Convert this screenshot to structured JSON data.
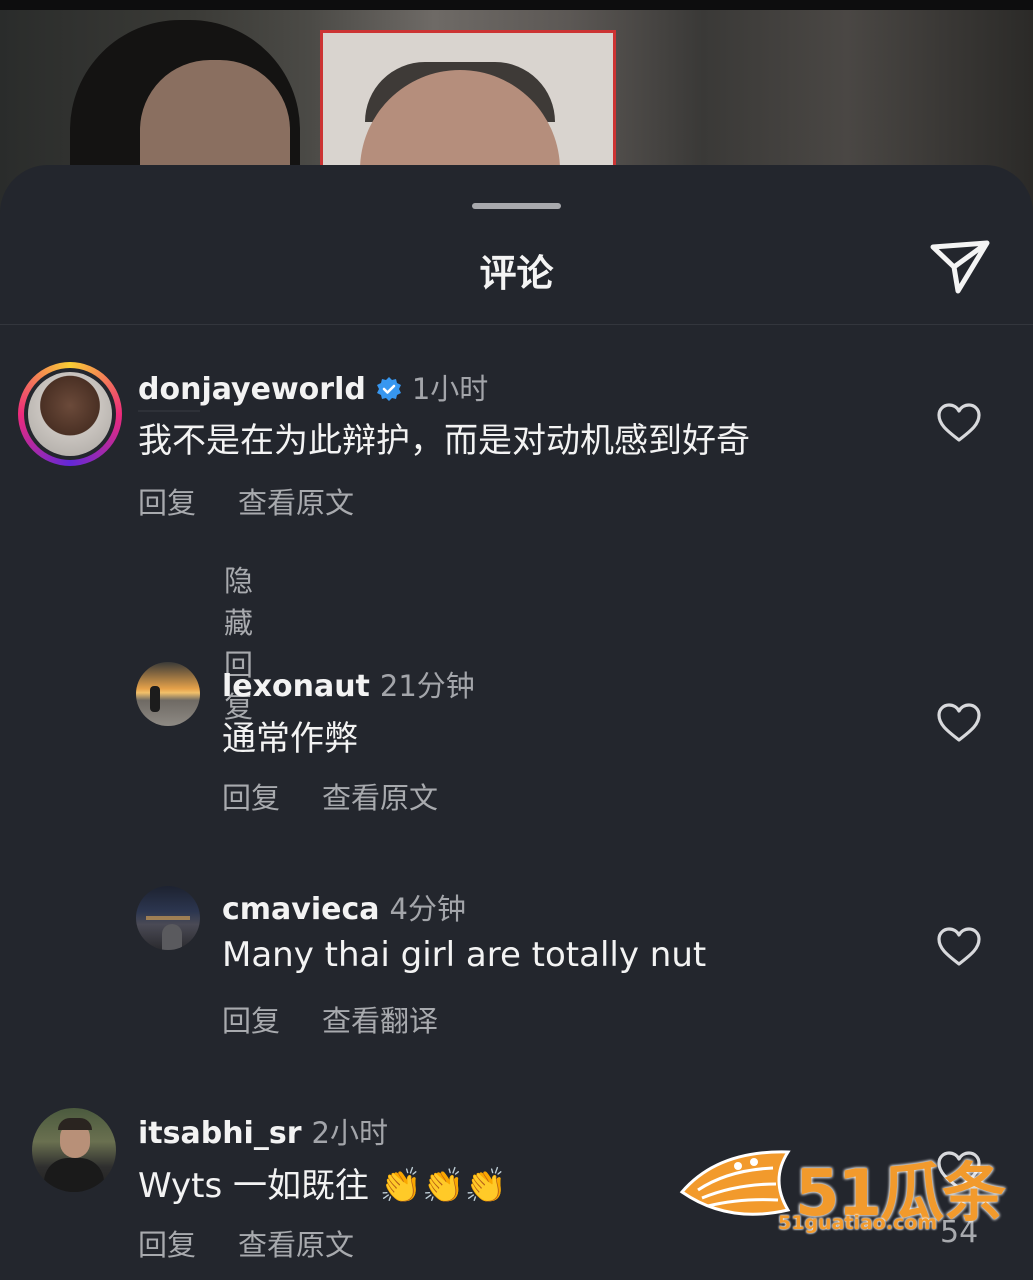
{
  "header": {
    "title": "评论"
  },
  "comments": [
    {
      "username": "donjayeworld",
      "verified": true,
      "time": "1小时",
      "text": "我不是在为此辩护，而是对动机感到好奇",
      "reply_label": "回复",
      "secondary_label": "查看原文",
      "hide_replies_label": "隐藏回复"
    },
    {
      "username": "lexonaut",
      "time": "21分钟",
      "text": "通常作弊",
      "reply_label": "回复",
      "secondary_label": "查看原文"
    },
    {
      "username": "cmavieca",
      "time": "4分钟",
      "text": "Many thai girl are totally nut",
      "reply_label": "回复",
      "secondary_label": "查看翻译"
    },
    {
      "username": "itsabhi_sr",
      "time": "2小时",
      "text": "Wyts 一如既往 👏👏👏",
      "reply_label": "回复",
      "secondary_label": "查看原文",
      "like_count": "54"
    }
  ],
  "watermark": {
    "brand": "51瓜条",
    "url": "51guatiao.com"
  },
  "colors": {
    "sheet": "#23262d",
    "verified": "#3797f0",
    "watermark": "#f29a2c",
    "story_ring": [
      "#f9ce34",
      "#ee2a7b",
      "#6228d7"
    ]
  },
  "icons": [
    "send-icon",
    "verified-icon",
    "heart-icon",
    "avatar"
  ]
}
